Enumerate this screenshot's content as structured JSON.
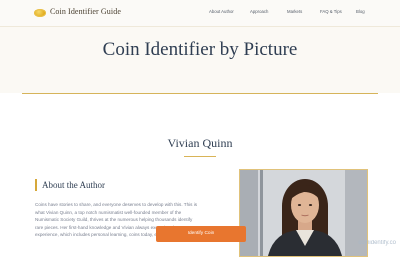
{
  "header": {
    "logo_text": "Coin Identifier Guide",
    "logo_icon": "coin-icon",
    "nav": [
      "About Author",
      "Approach",
      "Markets",
      "FAQ & Tips",
      "Blog"
    ]
  },
  "hero": {
    "title": "Coin Identifier by Picture"
  },
  "author": {
    "name": "Vivian Quinn",
    "about_heading": "About the Author",
    "bio_lines": [
      "Coins have stories to share, and everyone deserves to develop with this. This is",
      "what Vivian Quinn, a top notch numismatist well-founded member of the",
      "Numismatic Society Guild, thrives at the numerous helping thousands identify",
      "rare pieces. Her first-hand knowledge and Vivian always exceptional",
      "experience, which includes personal learning, coins today, eventual."
    ]
  },
  "cta": {
    "label": "Identify Coin"
  },
  "watermark": "coinidentify.co"
}
